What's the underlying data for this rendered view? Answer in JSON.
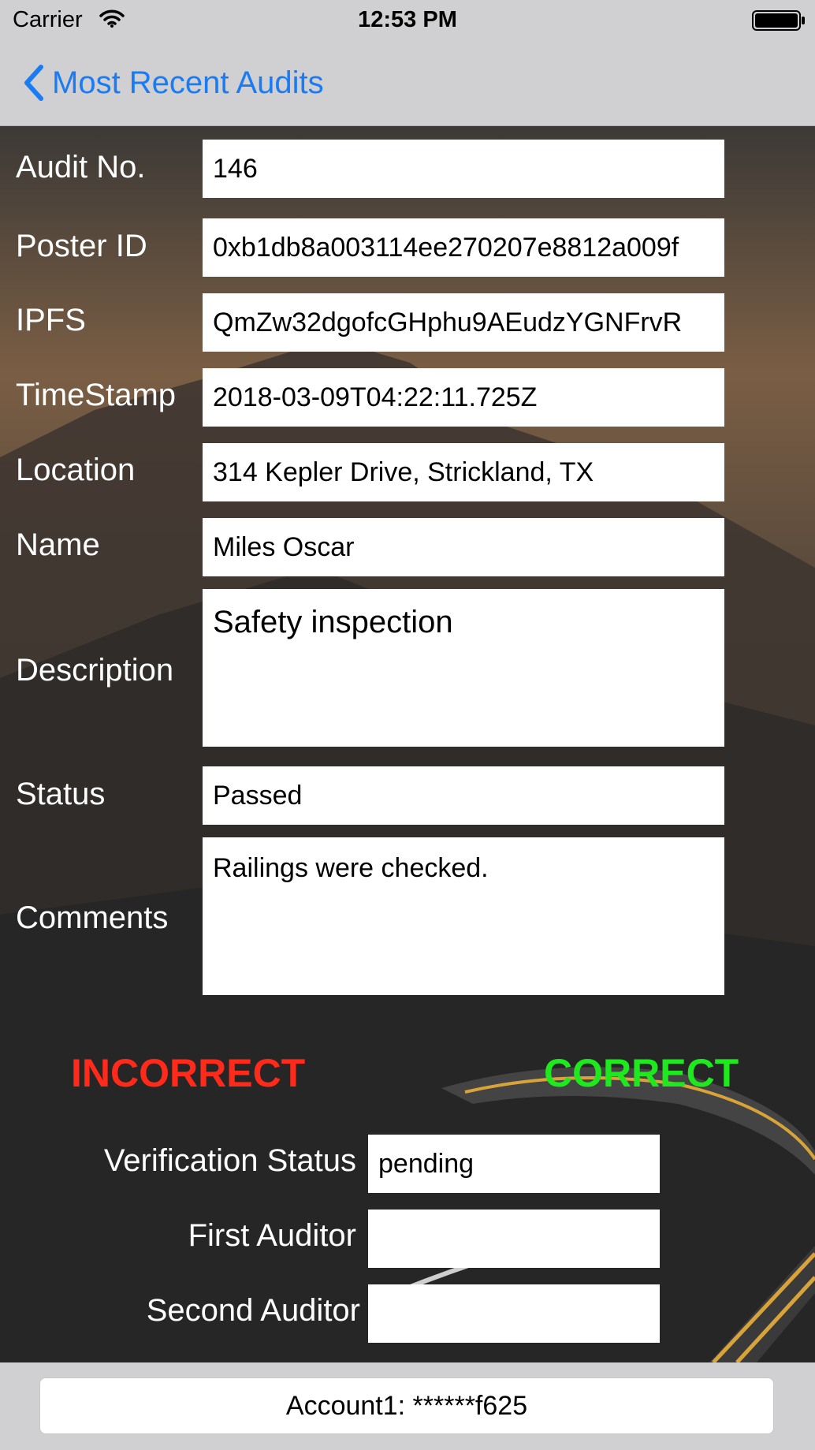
{
  "status_bar": {
    "carrier": "Carrier",
    "time": "12:53 PM"
  },
  "nav": {
    "back_label": "Most Recent Audits"
  },
  "fields": [
    {
      "label": "Audit No.",
      "value": "146"
    },
    {
      "label": "Poster ID",
      "value": "0xb1db8a003114ee270207e8812a009f"
    },
    {
      "label": "IPFS",
      "value": "QmZw32dgofcGHphu9AEudzYGNFrvR"
    },
    {
      "label": "TimeStamp",
      "value": "2018-03-09T04:22:11.725Z"
    },
    {
      "label": "Location",
      "value": "314 Kepler Drive, Strickland, TX"
    },
    {
      "label": "Name",
      "value": "Miles Oscar"
    },
    {
      "label": "Description",
      "value": "Safety inspection"
    },
    {
      "label": "Status",
      "value": "Passed"
    },
    {
      "label": "Comments",
      "value": "Railings were checked."
    }
  ],
  "actions": {
    "incorrect_label": "INCORRECT",
    "incorrect_color": "#ff2a1a",
    "correct_label": "CORRECT",
    "correct_color": "#1ee81e"
  },
  "verification": [
    {
      "label": "Verification Status",
      "value": "pending"
    },
    {
      "label": "First Auditor",
      "value": ""
    },
    {
      "label": "Second Auditor",
      "value": ""
    }
  ],
  "footer": {
    "account": "Account1: ******f625"
  }
}
